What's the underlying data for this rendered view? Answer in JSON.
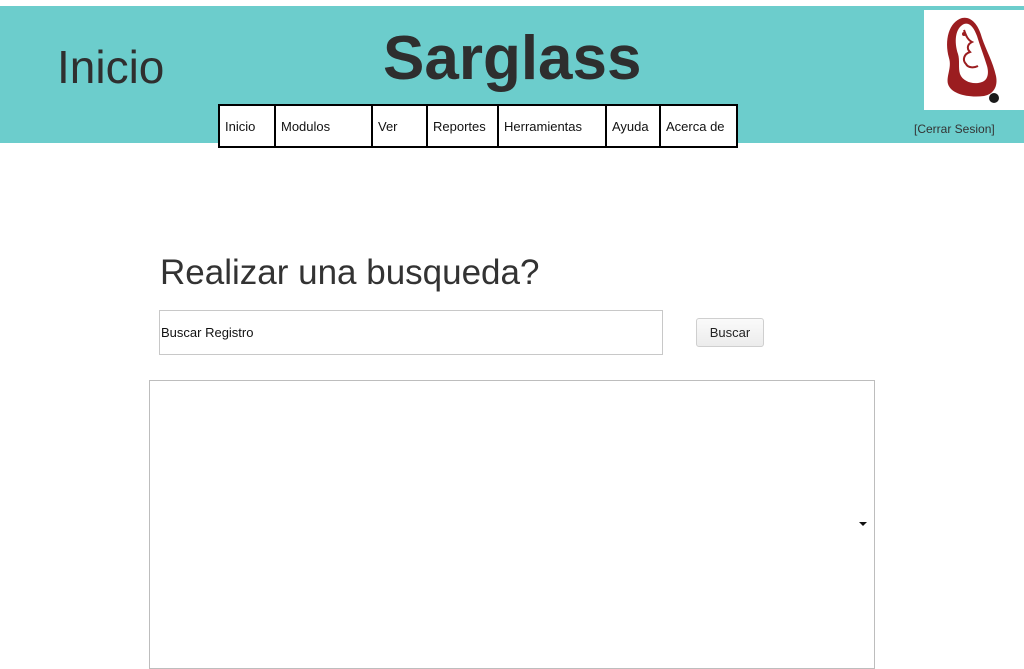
{
  "header": {
    "page_heading": "Inicio",
    "brand": "Sarglass",
    "logout_label": "[Cerrar Sesion]",
    "background_color": "#6ccdcc"
  },
  "menu": {
    "items": [
      {
        "label": "Inicio"
      },
      {
        "label": "Modulos"
      },
      {
        "label": "Ver"
      },
      {
        "label": "Reportes"
      },
      {
        "label": "Herramientas"
      },
      {
        "label": "Ayuda"
      },
      {
        "label": "Acerca de"
      }
    ]
  },
  "search": {
    "title": "Realizar una busqueda?",
    "placeholder": "Buscar Registro",
    "button_label": "Buscar"
  },
  "results": {
    "dropdown_icon": "caret-down-icon"
  },
  "logo": {
    "icon": "logo-icon",
    "accent_color": "#9b1d20"
  }
}
